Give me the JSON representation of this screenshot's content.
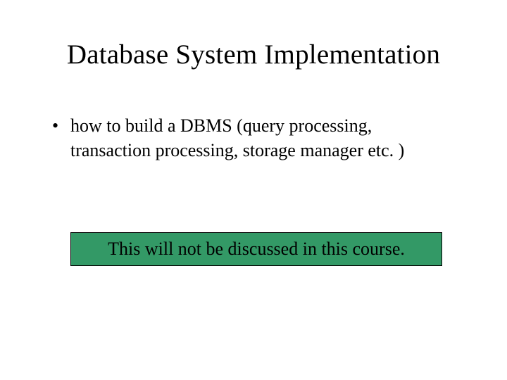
{
  "title": "Database System Implementation",
  "bullets": [
    "how to build a DBMS (query processing, transaction processing, storage manager etc. )"
  ],
  "callout": "This will not be discussed in this course.",
  "colors": {
    "callout_bg": "#339966",
    "text": "#000000",
    "bg": "#ffffff"
  }
}
